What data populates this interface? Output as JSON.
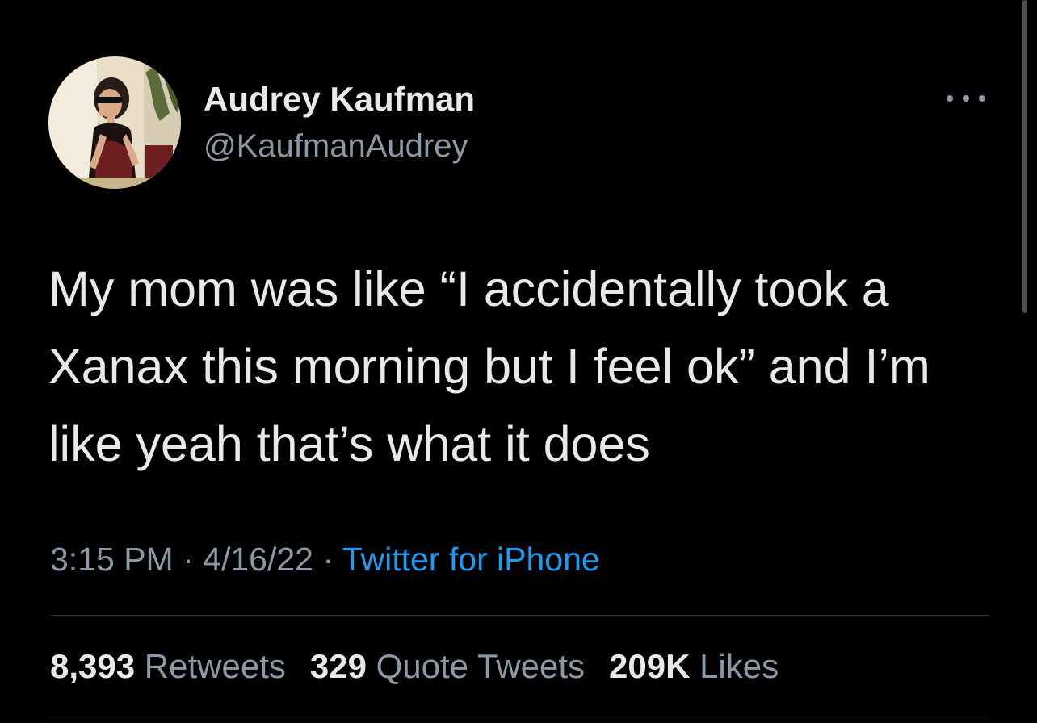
{
  "author": {
    "name": "Audrey Kaufman",
    "handle": "@KaufmanAudrey"
  },
  "tweet": {
    "text_lines": [
      "My mom was like “I accidentally took a",
      "Xanax this morning but I feel ok” and I’m",
      "like yeah that’s what it does"
    ]
  },
  "meta": {
    "time": "3:15 PM",
    "separator": "·",
    "date": "4/16/22",
    "source": "Twitter for iPhone"
  },
  "stats": {
    "retweets": {
      "count": "8,393",
      "label": "Retweets"
    },
    "quotes": {
      "count": "329",
      "label": "Quote Tweets"
    },
    "likes": {
      "count": "209K",
      "label": "Likes"
    }
  },
  "icons": {
    "more": "more-horizontal-icon"
  },
  "colors": {
    "background": "#000000",
    "primary_text": "#e7e9ea",
    "secondary_text": "#8b98a5",
    "link": "#1d9bf0",
    "divider": "#2f3336"
  }
}
